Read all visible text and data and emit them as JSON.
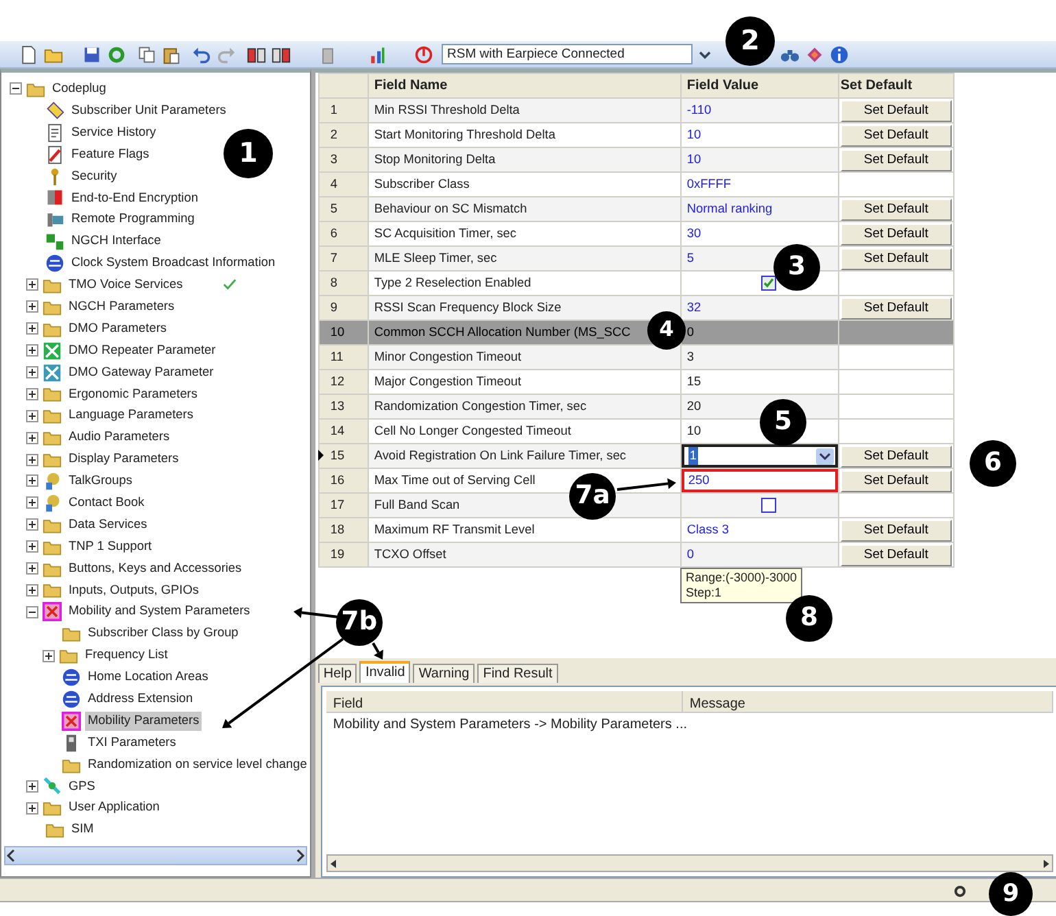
{
  "toolbar": {
    "profile": {
      "value": "RSM with Earpiece Connected"
    }
  },
  "tree": {
    "label": "Codeplug",
    "kind": "folder",
    "expanded": true,
    "selected": false,
    "children": [
      {
        "label": "Subscriber Unit Parameters",
        "kind": "tag",
        "selected": false
      },
      {
        "label": "Service History",
        "kind": "document",
        "selected": false
      },
      {
        "label": "Feature Flags",
        "kind": "pencil",
        "selected": false
      },
      {
        "label": "Security",
        "kind": "key",
        "selected": false
      },
      {
        "label": "End-to-End Encryption",
        "kind": "encryption",
        "selected": false
      },
      {
        "label": "Remote Programming",
        "kind": "computer",
        "selected": false
      },
      {
        "label": "NGCH Interface",
        "kind": "blocks",
        "selected": false
      },
      {
        "label": "Clock System Broadcast Information",
        "kind": "globe",
        "selected": false
      },
      {
        "label": "TMO Voice Services",
        "kind": "folder",
        "expanded": false,
        "selected": false,
        "validated": true
      },
      {
        "label": "NGCH Parameters",
        "kind": "folder",
        "expanded": false,
        "selected": false
      },
      {
        "label": "DMO Parameters",
        "kind": "folder",
        "expanded": false,
        "selected": false
      },
      {
        "label": "DMO Repeater Parameter",
        "kind": "repeater",
        "expanded": false,
        "selected": false
      },
      {
        "label": "DMO Gateway Parameter",
        "kind": "gateway",
        "expanded": false,
        "selected": false
      },
      {
        "label": "Ergonomic Parameters",
        "kind": "folder",
        "expanded": false,
        "selected": false
      },
      {
        "label": "Language Parameters",
        "kind": "folder",
        "expanded": false,
        "selected": false
      },
      {
        "label": "Audio Parameters",
        "kind": "folder",
        "expanded": false,
        "selected": false
      },
      {
        "label": "Display Parameters",
        "kind": "folder",
        "expanded": false,
        "selected": false
      },
      {
        "label": "TalkGroups",
        "kind": "people",
        "expanded": false,
        "selected": false
      },
      {
        "label": "Contact Book",
        "kind": "people",
        "expanded": false,
        "selected": false
      },
      {
        "label": "Data Services",
        "kind": "folder",
        "expanded": false,
        "selected": false
      },
      {
        "label": "TNP 1 Support",
        "kind": "folder",
        "expanded": false,
        "selected": false
      },
      {
        "label": "Buttons, Keys and Accessories",
        "kind": "folder",
        "expanded": false,
        "selected": false
      },
      {
        "label": "Inputs, Outputs, GPIOs",
        "kind": "folder",
        "expanded": false,
        "selected": false
      },
      {
        "label": "Mobility and System Parameters",
        "kind": "mobility",
        "expanded": true,
        "selected": false,
        "children": [
          {
            "label": "Subscriber Class by Group",
            "kind": "folder",
            "selected": false
          },
          {
            "label": "Frequency List",
            "kind": "folder",
            "expanded": false,
            "selected": false
          },
          {
            "label": "Home Location Areas",
            "kind": "globe",
            "selected": false
          },
          {
            "label": "Address Extension",
            "kind": "globe",
            "selected": false
          },
          {
            "label": "Mobility Parameters",
            "kind": "mobility",
            "selected": true
          },
          {
            "label": "TXI Parameters",
            "kind": "phone",
            "selected": false
          },
          {
            "label": "Randomization on service level change",
            "kind": "folder",
            "selected": false
          }
        ]
      },
      {
        "label": "GPS",
        "kind": "satellite",
        "expanded": false,
        "selected": false
      },
      {
        "label": "User Application",
        "kind": "folder",
        "expanded": false,
        "selected": false
      },
      {
        "label": "SIM",
        "kind": "folder",
        "selected": false
      }
    ]
  },
  "table": {
    "columns": [
      "Field Name",
      "Field Value",
      "Set Default"
    ],
    "rows": [
      {
        "number": "1",
        "name": "Min RSSI Threshold Delta",
        "kind": "text",
        "value": "-110",
        "emphasis": true,
        "default_button": "Set Default",
        "disabled": false,
        "current": false
      },
      {
        "number": "2",
        "name": "Start Monitoring Threshold Delta",
        "kind": "text",
        "value": "10",
        "emphasis": true,
        "default_button": "Set Default",
        "disabled": false,
        "current": false
      },
      {
        "number": "3",
        "name": "Stop Monitoring Delta",
        "kind": "text",
        "value": "10",
        "emphasis": true,
        "default_button": "Set Default",
        "disabled": false,
        "current": false
      },
      {
        "number": "4",
        "name": "Subscriber Class",
        "kind": "text",
        "value": "0xFFFF",
        "emphasis": true,
        "disabled": false,
        "current": false
      },
      {
        "number": "5",
        "name": "Behaviour on SC Mismatch",
        "kind": "text",
        "value": "Normal ranking",
        "emphasis": true,
        "default_button": "Set Default",
        "disabled": false,
        "current": false
      },
      {
        "number": "6",
        "name": "SC Acquisition Timer, sec",
        "kind": "text",
        "value": "30",
        "emphasis": true,
        "default_button": "Set Default",
        "disabled": false,
        "current": false
      },
      {
        "number": "7",
        "name": "MLE Sleep Timer, sec",
        "kind": "text",
        "value": "5",
        "emphasis": true,
        "default_button": "Set Default",
        "disabled": false,
        "current": false
      },
      {
        "number": "8",
        "name": "Type 2 Reselection Enabled",
        "kind": "checkbox",
        "checked": true,
        "disabled": false,
        "current": false
      },
      {
        "number": "9",
        "name": "RSSI Scan Frequency Block Size",
        "kind": "text",
        "value": "32",
        "emphasis": true,
        "default_button": "Set Default",
        "disabled": false,
        "current": false
      },
      {
        "number": "10",
        "name": "Common SCCH Allocation Number (MS_SCC",
        "kind": "text",
        "value": "0",
        "emphasis": false,
        "disabled": true,
        "current": false
      },
      {
        "number": "11",
        "name": "Minor Congestion Timeout",
        "kind": "text",
        "value": "3",
        "emphasis": false,
        "disabled": false,
        "current": false
      },
      {
        "number": "12",
        "name": "Major Congestion Timeout",
        "kind": "text",
        "value": "15",
        "emphasis": false,
        "disabled": false,
        "current": false
      },
      {
        "number": "13",
        "name": "Randomization Congestion Timer, sec",
        "kind": "text",
        "value": "20",
        "emphasis": false,
        "disabled": false,
        "current": false
      },
      {
        "number": "14",
        "name": "Cell No Longer Congested Timeout",
        "kind": "text",
        "value": "10",
        "emphasis": false,
        "disabled": false,
        "current": false
      },
      {
        "number": "15",
        "name": "Avoid Registration On Link Failure Timer, sec",
        "kind": "dropdown",
        "value": "1",
        "default_button": "Set Default",
        "disabled": false,
        "current": true
      },
      {
        "number": "16",
        "name": "Max Time out of Serving Cell",
        "kind": "error",
        "value": "250",
        "emphasis": true,
        "default_button": "Set Default",
        "disabled": false,
        "current": false
      },
      {
        "number": "17",
        "name": "Full Band Scan",
        "kind": "checkbox",
        "checked": false,
        "disabled": false,
        "current": false
      },
      {
        "number": "18",
        "name": "Maximum RF Transmit Level",
        "kind": "text",
        "value": "Class 3",
        "emphasis": true,
        "default_button": "Set Default",
        "disabled": false,
        "current": false
      },
      {
        "number": "19",
        "name": "TCXO Offset",
        "kind": "text",
        "value": "0",
        "emphasis": true,
        "default_button": "Set Default",
        "disabled": false,
        "current": false
      }
    ]
  },
  "tooltip": {
    "lines": [
      "Range:(-3000)-3000",
      "Step:1"
    ]
  },
  "bottom_panel": {
    "tabs": [
      {
        "label": "Help",
        "selected": false
      },
      {
        "label": "Invalid",
        "selected": true
      },
      {
        "label": "Warning",
        "selected": false
      },
      {
        "label": "Find Result",
        "selected": false
      }
    ],
    "columns": [
      "Field",
      "Message"
    ],
    "rows": [
      {
        "field": "Mobility and System Parameters -> Mobility Parameters ..."
      }
    ]
  },
  "callouts": [
    {
      "label": "1"
    },
    {
      "label": "2"
    },
    {
      "label": "3"
    },
    {
      "label": "4"
    },
    {
      "label": "5"
    },
    {
      "label": "6"
    },
    {
      "label": "7a"
    },
    {
      "label": "7b"
    },
    {
      "label": "8"
    },
    {
      "label": "9"
    }
  ]
}
